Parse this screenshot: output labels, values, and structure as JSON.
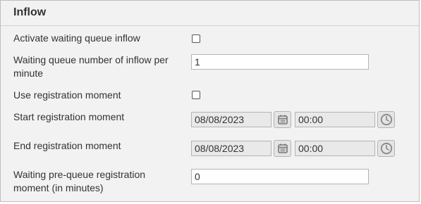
{
  "panel": {
    "title": "Inflow"
  },
  "fields": {
    "activate_inflow": {
      "label": "Activate waiting queue inflow",
      "checked": false
    },
    "inflow_per_minute": {
      "label": "Waiting queue number of inflow per minute",
      "value": "1"
    },
    "use_registration_moment": {
      "label": "Use registration moment",
      "checked": false
    },
    "start_registration": {
      "label": "Start registration moment",
      "date": "08/08/2023",
      "time": "00:00"
    },
    "end_registration": {
      "label": "End registration moment",
      "date": "08/08/2023",
      "time": "00:00"
    },
    "pre_queue_minutes": {
      "label": "Waiting pre-queue registration moment (in minutes)",
      "value": "0"
    }
  },
  "icons": {
    "date_picker": "calendar-icon",
    "time_picker": "clock-icon"
  },
  "colors": {
    "panel_bg": "#f2f2f2",
    "disabled_input_bg": "#e9e9e9",
    "icon_gray": "#888888"
  }
}
